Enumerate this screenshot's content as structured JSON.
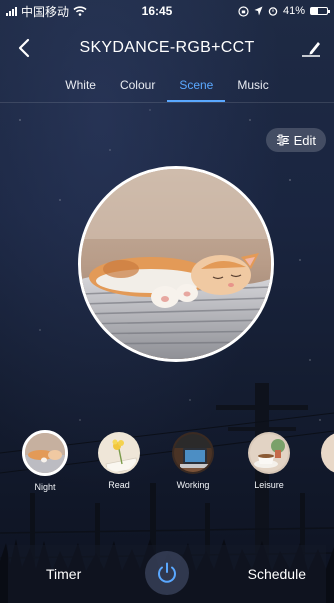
{
  "status_bar": {
    "carrier": "中国移动",
    "time": "16:45",
    "battery_percent": "41%",
    "battery_level": 0.41
  },
  "header": {
    "title": "SKYDANCE-RGB+CCT"
  },
  "tabs": [
    {
      "label": "White"
    },
    {
      "label": "Colour"
    },
    {
      "label": "Scene"
    },
    {
      "label": "Music"
    }
  ],
  "active_tab": "Scene",
  "edit_chip": {
    "label": "Edit"
  },
  "scenes": [
    {
      "label": "Night",
      "selected": true
    },
    {
      "label": "Read",
      "selected": false
    },
    {
      "label": "Working",
      "selected": false
    },
    {
      "label": "Leisure",
      "selected": false
    }
  ],
  "bottom_bar": {
    "timer_label": "Timer",
    "schedule_label": "Schedule"
  },
  "colors": {
    "accent": "#5aa8ff",
    "background": "#1a2540"
  }
}
